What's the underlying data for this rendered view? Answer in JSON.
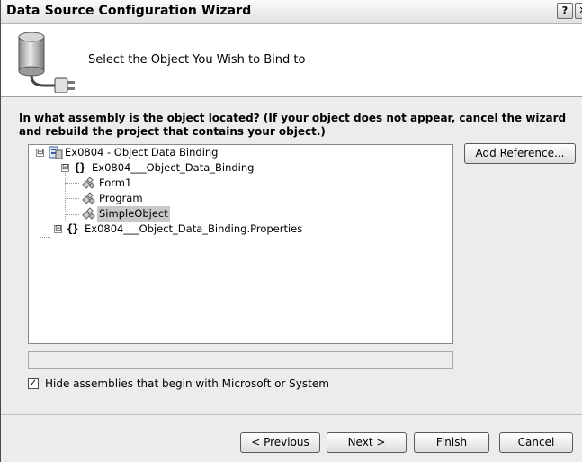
{
  "window": {
    "title": "Data Source Configuration Wizard",
    "help_glyph": "?",
    "close_glyph": "✕"
  },
  "header": {
    "title": "Select the Object You Wish to Bind to",
    "icon": "database-plug-icon"
  },
  "question": "In what assembly is the object located? (If your object does not appear, cancel the wizard and rebuild the project that contains your object.)",
  "tree": {
    "nodes": [
      {
        "label": "Ex0804 - Object Data Binding",
        "icon": "project-icon",
        "expander": "⊟"
      },
      {
        "label": "Ex0804___Object_Data_Binding",
        "icon": "namespace-icon",
        "expander": "⊟"
      },
      {
        "label": "Form1",
        "icon": "class-icon"
      },
      {
        "label": "Program",
        "icon": "class-icon"
      },
      {
        "label": "SimpleObject",
        "icon": "class-icon",
        "selected": true
      },
      {
        "label": "Ex0804___Object_Data_Binding.Properties",
        "icon": "namespace-icon",
        "expander": "⊞"
      }
    ]
  },
  "add_reference_label": "Add Reference...",
  "status_text": "",
  "hide_assemblies": {
    "label": "Hide assemblies that begin with Microsoft or System",
    "checked": true
  },
  "buttons": {
    "previous": "< Previous",
    "next": "Next >",
    "finish": "Finish",
    "cancel": "Cancel"
  }
}
